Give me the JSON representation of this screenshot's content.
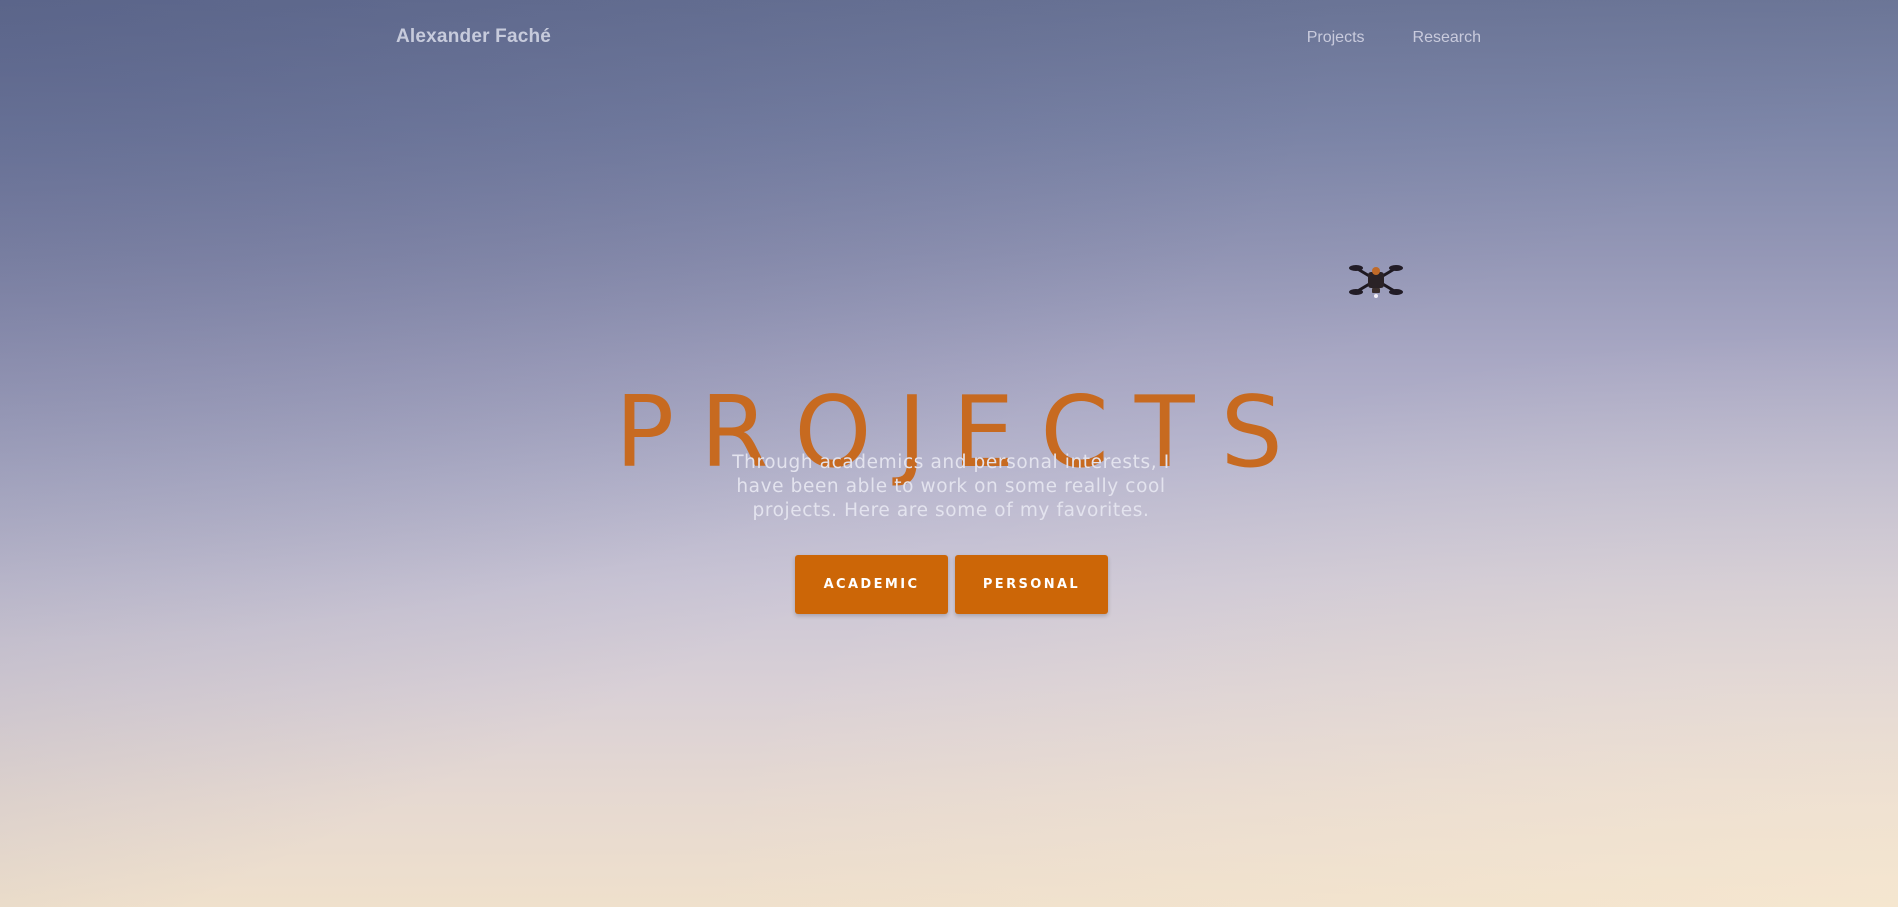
{
  "nav": {
    "brand": "Alexander Faché",
    "links": [
      {
        "label": "Projects"
      },
      {
        "label": "Research"
      }
    ]
  },
  "hero": {
    "title": "PROJECTS",
    "subtitle": "Through academics and personal interests, I have been able to work on some really cool projects. Here are some of my favorites.",
    "buttons": [
      {
        "label": "ACADEMIC"
      },
      {
        "label": "PERSONAL"
      }
    ],
    "background_image": "drone-in-sky",
    "icons": {
      "drone": "drone-icon"
    }
  },
  "colors": {
    "accent": "#cc6607",
    "title": "#c76a20",
    "sky_top": "#6c7697",
    "sky_bottom": "#efe0cc"
  }
}
